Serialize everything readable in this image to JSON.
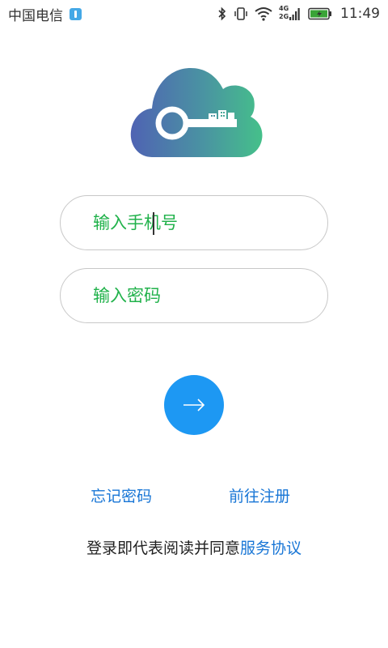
{
  "status_bar": {
    "carrier": "中国电信",
    "network_top": "4G",
    "network_bottom": "2G",
    "time": "11:49"
  },
  "login": {
    "phone_placeholder": "输入手机号",
    "password_placeholder": "输入密码",
    "submit_icon": "arrow-right-icon",
    "forgot_password": "忘记密码",
    "register": "前往注册",
    "agreement_text": "登录即代表阅读并同意",
    "agreement_link": "服务协议"
  },
  "colors": {
    "placeholder_green": "#21b24b",
    "accent_blue": "#1d98f3",
    "link_blue": "#1876d6",
    "logo_gradient_start": "#4f6fb5",
    "logo_gradient_end": "#45c08a"
  }
}
